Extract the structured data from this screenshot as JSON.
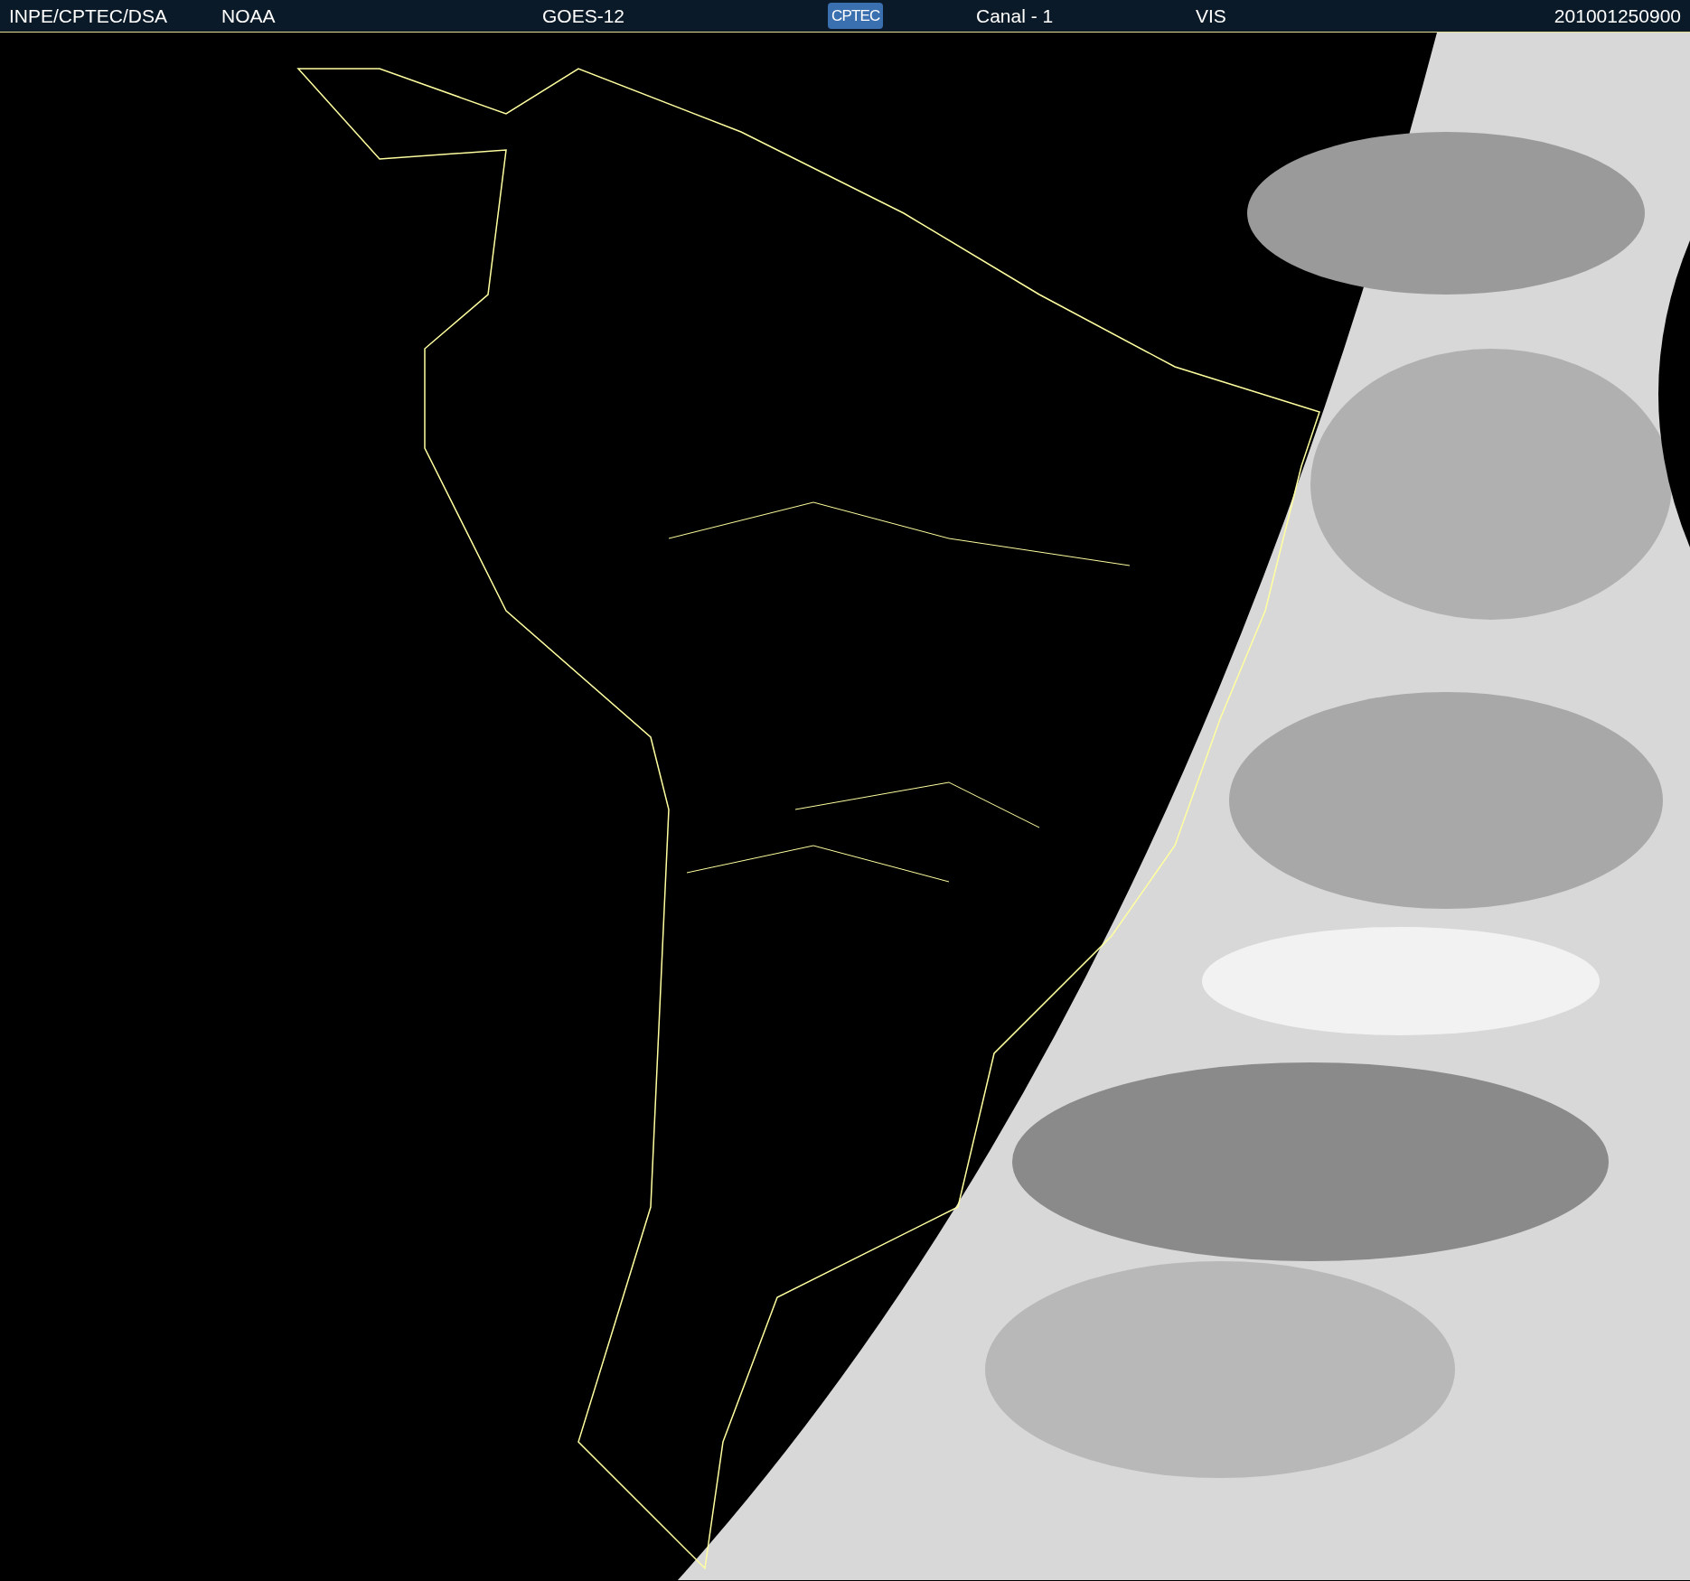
{
  "header": {
    "items": [
      {
        "kind": "text",
        "label": "INPE/CPTEC/DSA"
      },
      {
        "kind": "text",
        "label": "NOAA"
      },
      {
        "kind": "text",
        "label": "GOES-12"
      },
      {
        "kind": "logo",
        "label": "CPTEC"
      },
      {
        "kind": "text",
        "label": "Canal - 1"
      },
      {
        "kind": "text",
        "label": "VIS"
      },
      {
        "kind": "text",
        "label": "201001250900"
      }
    ]
  }
}
